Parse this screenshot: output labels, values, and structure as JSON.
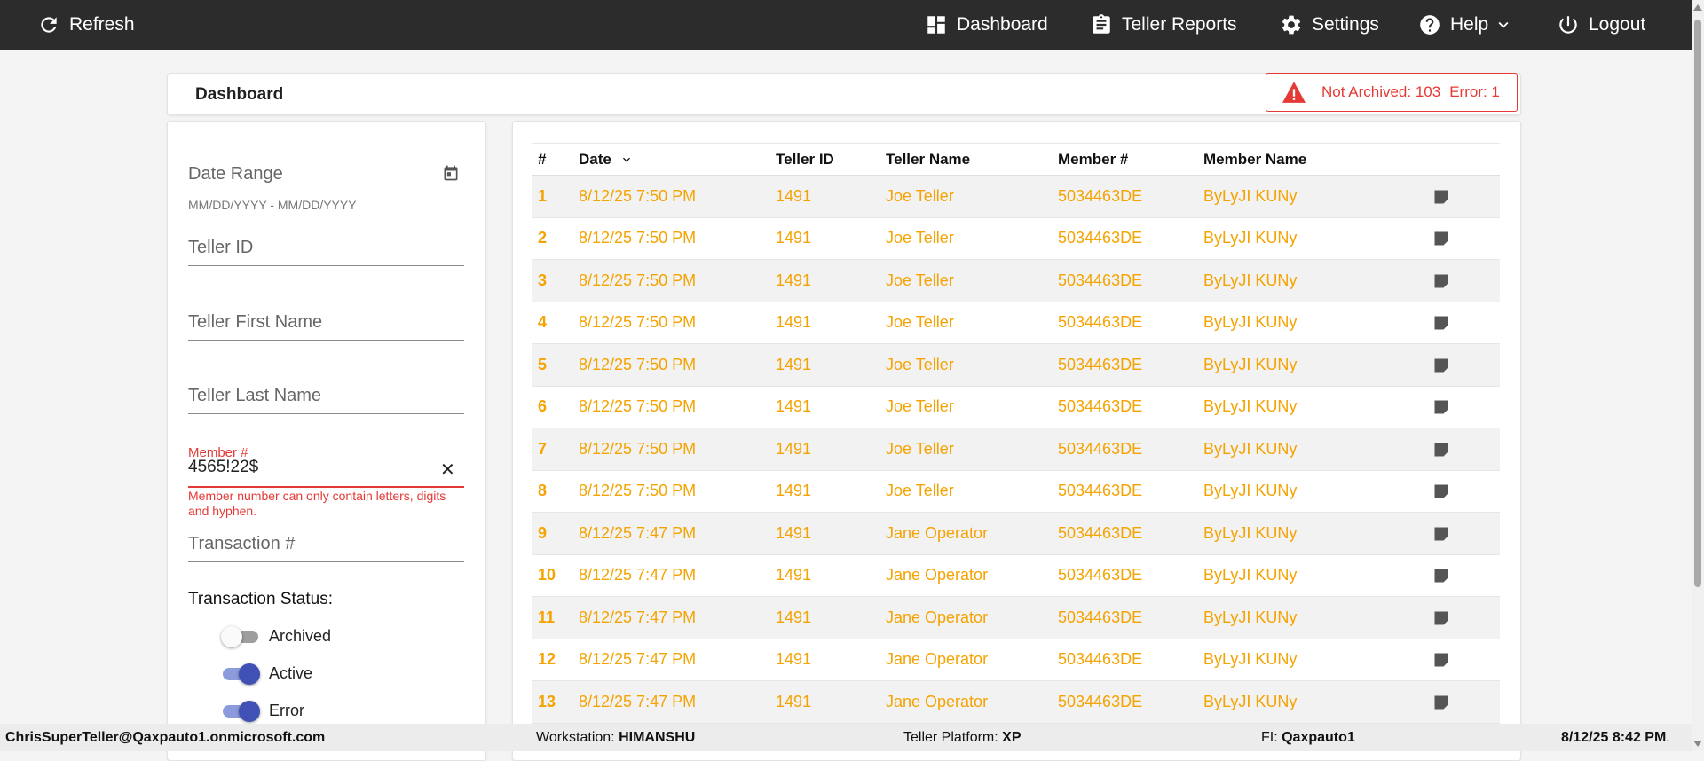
{
  "nav": {
    "refresh": "Refresh",
    "dashboard": "Dashboard",
    "teller_reports": "Teller Reports",
    "settings": "Settings",
    "help": "Help",
    "logout": "Logout"
  },
  "header": {
    "title": "Dashboard"
  },
  "alert": {
    "not_archived": "Not Archived: 103",
    "error": "Error: 1",
    "color": "#e53935"
  },
  "filters": {
    "date_range": "Date Range",
    "date_hint": "MM/DD/YYYY - MM/DD/YYYY",
    "teller_id": "Teller ID",
    "teller_first": "Teller First Name",
    "teller_last": "Teller Last Name",
    "member_label": "Member #",
    "member_value": "4565!22$",
    "member_clear": "✕",
    "member_error": "Member number can only contain letters, digits and hyphen.",
    "transaction": "Transaction #",
    "status_title": "Transaction Status:",
    "status": [
      {
        "label": "Archived",
        "on": false
      },
      {
        "label": "Active",
        "on": true
      },
      {
        "label": "Error",
        "on": true
      }
    ]
  },
  "table": {
    "columns": [
      "#",
      "Date",
      "Teller ID",
      "Teller Name",
      "Member #",
      "Member Name"
    ],
    "rows": [
      [
        "1",
        "8/12/25 7:50 PM",
        "1491",
        "Joe Teller",
        "5034463DE",
        "ByLyJI KUNy"
      ],
      [
        "2",
        "8/12/25 7:50 PM",
        "1491",
        "Joe Teller",
        "5034463DE",
        "ByLyJI KUNy"
      ],
      [
        "3",
        "8/12/25 7:50 PM",
        "1491",
        "Joe Teller",
        "5034463DE",
        "ByLyJI KUNy"
      ],
      [
        "4",
        "8/12/25 7:50 PM",
        "1491",
        "Joe Teller",
        "5034463DE",
        "ByLyJI KUNy"
      ],
      [
        "5",
        "8/12/25 7:50 PM",
        "1491",
        "Joe Teller",
        "5034463DE",
        "ByLyJI KUNy"
      ],
      [
        "6",
        "8/12/25 7:50 PM",
        "1491",
        "Joe Teller",
        "5034463DE",
        "ByLyJI KUNy"
      ],
      [
        "7",
        "8/12/25 7:50 PM",
        "1491",
        "Joe Teller",
        "5034463DE",
        "ByLyJI KUNy"
      ],
      [
        "8",
        "8/12/25 7:50 PM",
        "1491",
        "Joe Teller",
        "5034463DE",
        "ByLyJI KUNy"
      ],
      [
        "9",
        "8/12/25 7:47 PM",
        "1491",
        "Jane Operator",
        "5034463DE",
        "ByLyJI KUNy"
      ],
      [
        "10",
        "8/12/25 7:47 PM",
        "1491",
        "Jane Operator",
        "5034463DE",
        "ByLyJI KUNy"
      ],
      [
        "11",
        "8/12/25 7:47 PM",
        "1491",
        "Jane Operator",
        "5034463DE",
        "ByLyJI KUNy"
      ],
      [
        "12",
        "8/12/25 7:47 PM",
        "1491",
        "Jane Operator",
        "5034463DE",
        "ByLyJI KUNy"
      ],
      [
        "13",
        "8/12/25 7:47 PM",
        "1491",
        "Jane Operator",
        "5034463DE",
        "ByLyJI KUNy"
      ]
    ],
    "row_color": "#f5a300"
  },
  "footer": {
    "user": "ChrisSuperTeller@Qaxpauto1.onmicrosoft.com",
    "workstation_label": "Workstation: ",
    "workstation": "HIMANSHU",
    "platform_label": "Teller Platform: ",
    "platform": "XP",
    "fi_label": "FI: ",
    "fi": "Qaxpauto1",
    "datetime": "8/12/25 8:42 PM",
    "datetime_suffix": "."
  }
}
